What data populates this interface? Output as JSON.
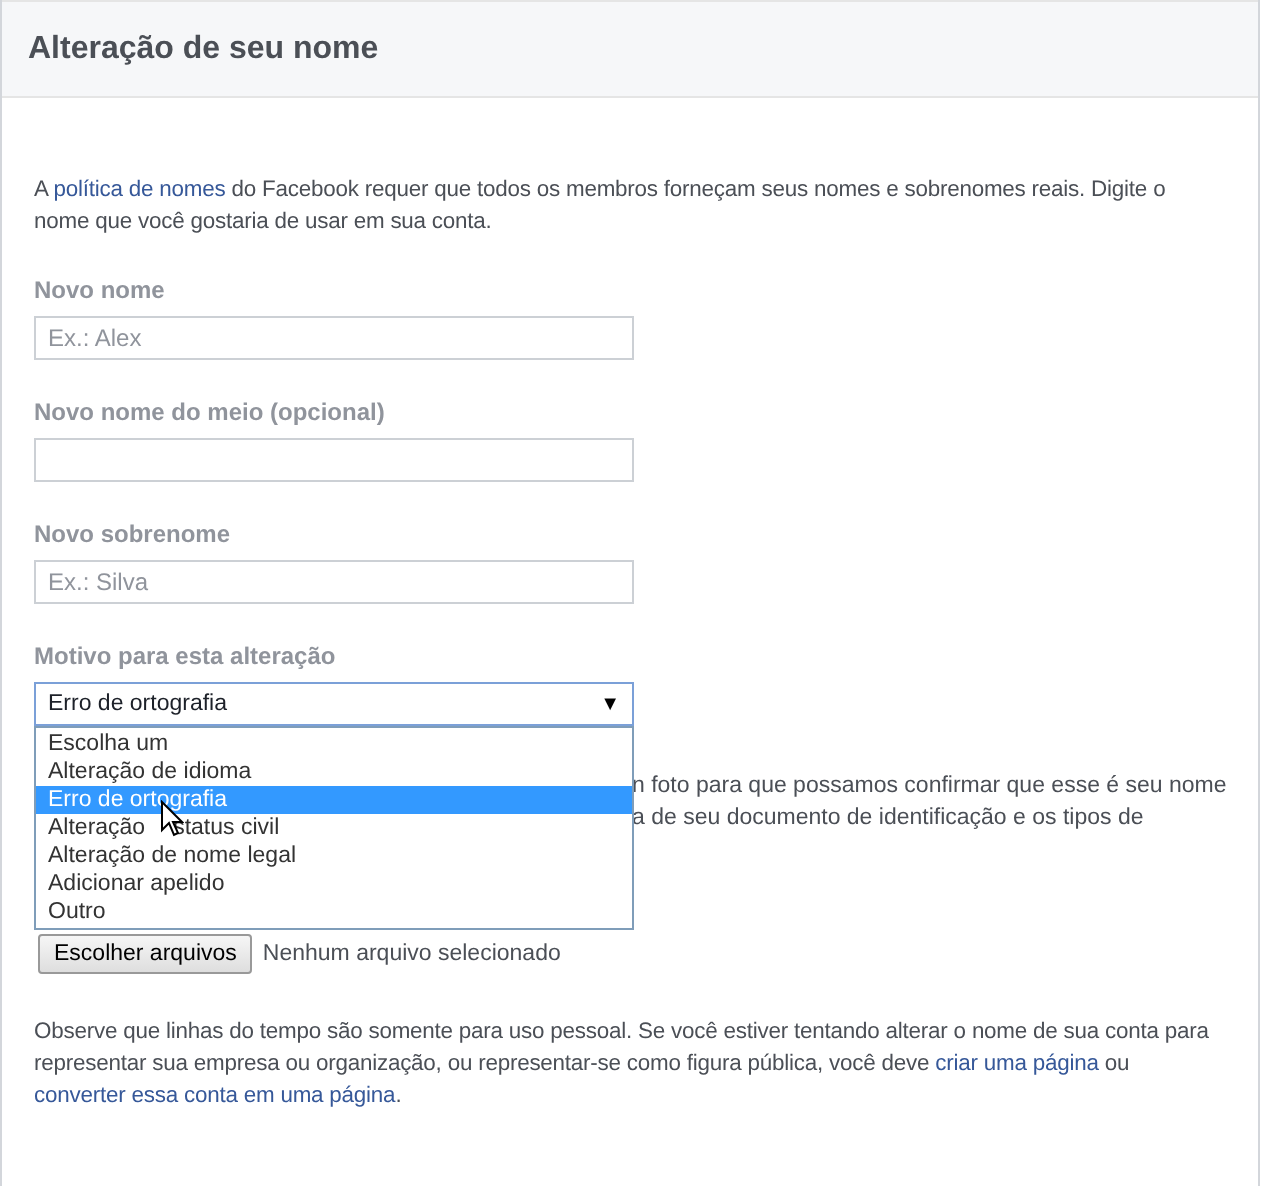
{
  "header": {
    "title": "Alteração de seu nome"
  },
  "intro": [
    {
      "text": "A "
    },
    {
      "text": "política de nomes",
      "link": true
    },
    {
      "text": " do Facebook requer que todos os membros forneçam seus nomes e sobrenomes reais. Digite o nome que você gostaria de usar em sua conta."
    }
  ],
  "fields": [
    {
      "label": "Novo nome",
      "placeholder": "Ex.: Alex"
    },
    {
      "label": "Novo nome do meio (opcional)"
    },
    {
      "label": "Novo sobrenome",
      "placeholder": "Ex.: Silva"
    }
  ],
  "reason": {
    "label": "Motivo para esta alteração",
    "value": "Erro de ortografia",
    "arrow": "▼",
    "expanded": true,
    "options": [
      {
        "label": "Escolha um",
        "selected": false
      },
      {
        "label": "Alteração de idioma",
        "selected": false
      },
      {
        "label": "Erro de ortografia",
        "selected": true
      },
      {
        "label": "Alteração",
        "label_end": "status civil",
        "selected": false
      },
      {
        "label": "Alteração de nome legal",
        "selected": false
      },
      {
        "label": "Adicionar apelido",
        "selected": false
      },
      {
        "label": "Outro",
        "selected": false
      }
    ]
  },
  "covered_text": [
    "n foto para que possamos confirmar que esse é seu nome",
    "a de seu documento de identificação e os tipos de"
  ],
  "file": {
    "button": "Escolher arquivos",
    "status": "Nenhum arquivo selecionado"
  },
  "note": [
    {
      "text": "Observe que linhas do tempo são somente para uso pessoal. Se você estiver tentando alterar o nome de sua conta para representar sua empresa ou organização, ou representar-se como figura pública, você deve "
    },
    {
      "text": "criar uma página",
      "link": true
    },
    {
      "text": " ou "
    },
    {
      "text": "converter essa conta em uma página",
      "link": true
    },
    {
      "text": "."
    }
  ]
}
